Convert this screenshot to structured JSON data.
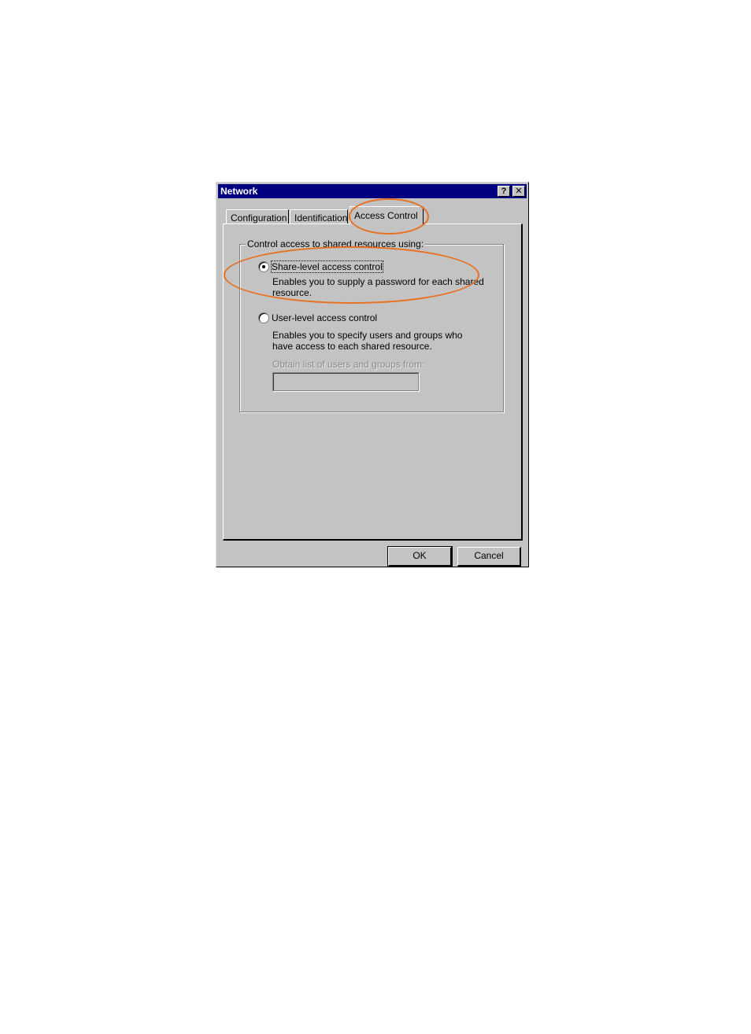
{
  "window": {
    "title": "Network",
    "help_glyph": "?",
    "close_glyph": "✕"
  },
  "tabs": [
    {
      "label": "Configuration",
      "active": false
    },
    {
      "label": "Identification",
      "active": false
    },
    {
      "label": "Access Control",
      "active": true
    }
  ],
  "group": {
    "legend": "Control access to shared resources using:",
    "share_level": {
      "label": "Share-level access control",
      "description": "Enables you to supply a password for each shared resource.",
      "checked": true
    },
    "user_level": {
      "label": "User-level access control",
      "description": "Enables you to specify users and groups who have access to each shared resource.",
      "checked": false
    },
    "obtain_list_label": "Obtain list of users and groups from:",
    "obtain_list_value": ""
  },
  "buttons": {
    "ok": "OK",
    "cancel": "Cancel"
  },
  "colors": {
    "titlebar": "#000080",
    "dialog_face": "#c3c3c3",
    "annotation": "#e8701f"
  }
}
